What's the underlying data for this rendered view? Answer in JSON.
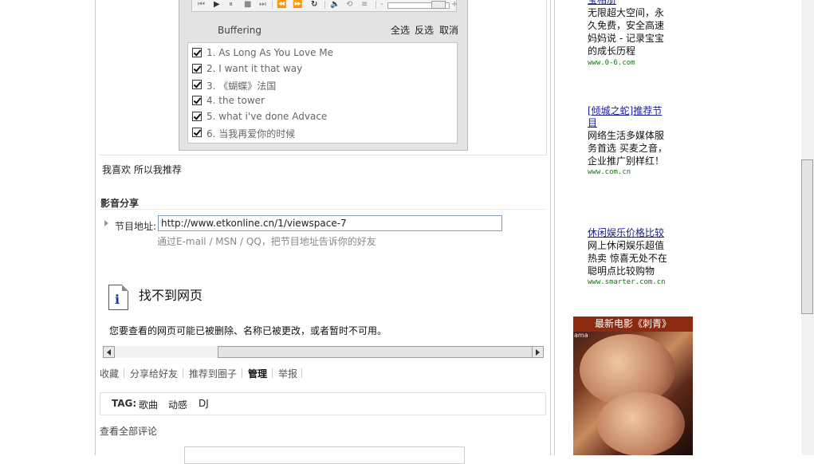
{
  "player": {
    "status": "Buffering",
    "select_all": "全选",
    "invert": "反选",
    "cancel": "取消",
    "tracks": [
      {
        "label": "1. As Long As You Love Me",
        "checked": true
      },
      {
        "label": "2. I want it that way",
        "checked": true
      },
      {
        "label": "3. 《蝴蝶》法国",
        "checked": true
      },
      {
        "label": "4. the tower",
        "checked": true
      },
      {
        "label": "5. what i've done Advace",
        "checked": true
      },
      {
        "label": "6. 当我再爱你的时候",
        "checked": true
      }
    ],
    "volume_minus": "-",
    "volume_plus": "+"
  },
  "recommend_text": "我喜欢 所以我推荐",
  "share": {
    "title": "影音分享",
    "address_label": "节目地址:",
    "address_value": "http://www.etkonline.cn/1/viewspace-7",
    "hint": "通过E-mail / MSN / QQ，把节目地址告诉你的好友"
  },
  "not_found": {
    "icon_letter": "i",
    "title": "找不到网页",
    "message": "您要查看的网页可能已被删除、名称已被更改，或者暂时不可用。"
  },
  "actions": [
    "收藏",
    "分享给好友",
    "推荐到圈子",
    "管理",
    "举报"
  ],
  "tags": {
    "title": "TAG:",
    "items": [
      "歌曲",
      "动感",
      "DJ"
    ]
  },
  "all_comments": "查看全部评论",
  "ads": [
    {
      "title": "宝相册",
      "body": [
        "无限超大空间，永",
        "久免费，安全高速",
        "妈妈说 - 记录宝宝",
        "的成长历程"
      ],
      "url": "www.0-6.com"
    },
    {
      "title": [
        "[倾城之蛇]推荐节",
        "目"
      ],
      "body": [
        "网络生活多媒体服",
        "务首选 买麦之音，",
        "企业推广别样红！"
      ],
      "url": "www.com.cn"
    },
    {
      "title": "休闲娱乐价格比较",
      "body": [
        "网上休闲娱乐超值",
        "热卖 惊喜无处不在",
        "聪明点比较购物"
      ],
      "url": "www.smarter.com.cn"
    }
  ],
  "movie_banner": {
    "title": "最新电影《刺青》",
    "side_text": "ama"
  }
}
